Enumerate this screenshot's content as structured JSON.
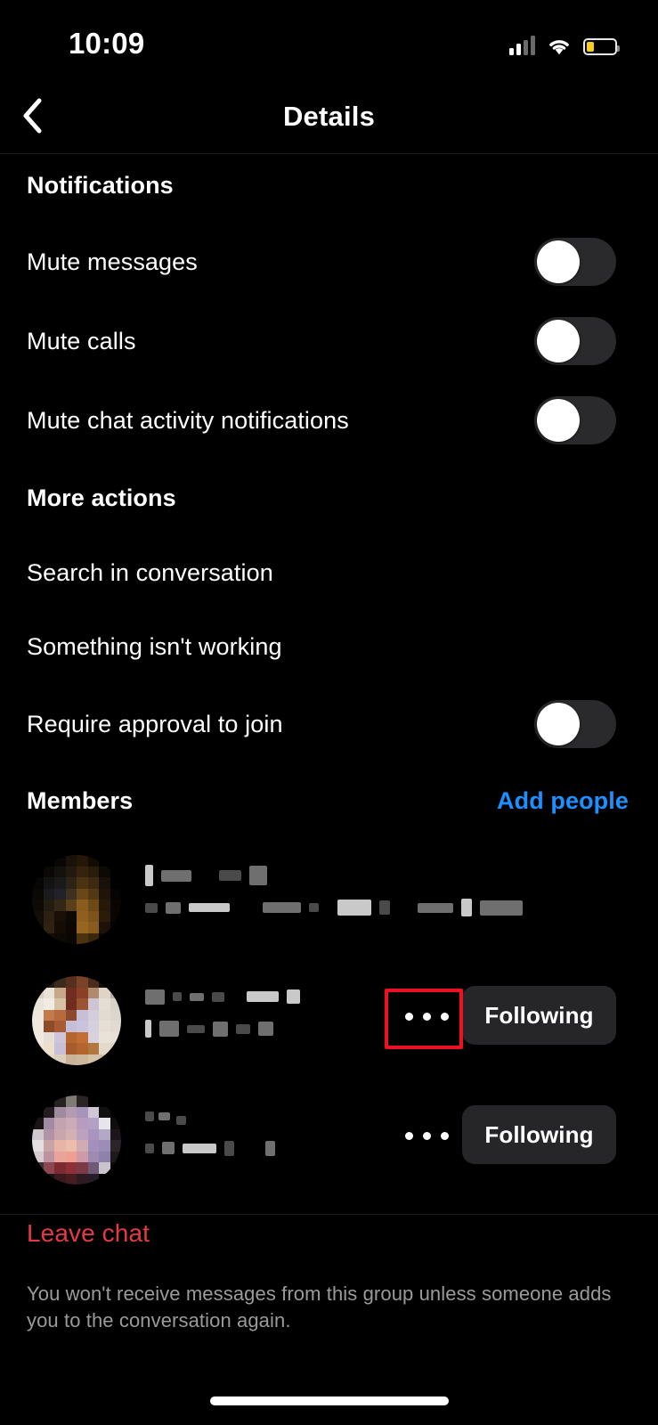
{
  "status_bar": {
    "time": "10:09",
    "signal_icon": "cellular-signal-icon",
    "wifi_icon": "wifi-icon",
    "battery_icon": "battery-low-icon",
    "battery_color": "#f5cf1d"
  },
  "nav": {
    "back_icon": "chevron-left-icon",
    "title": "Details"
  },
  "sections": {
    "notifications": {
      "heading": "Notifications",
      "rows": [
        {
          "label": "Mute messages",
          "toggle": "off"
        },
        {
          "label": "Mute calls",
          "toggle": "off"
        },
        {
          "label": "Mute chat activity notifications",
          "toggle": "off"
        }
      ]
    },
    "more_actions": {
      "heading": "More actions",
      "rows": [
        {
          "label": "Search in conversation",
          "toggle": null
        },
        {
          "label": "Something isn't working",
          "toggle": null
        },
        {
          "label": "Require approval to join",
          "toggle": "off"
        }
      ]
    },
    "members": {
      "heading": "Members",
      "add_people_label": "Add people",
      "rows": [
        {
          "name": "",
          "subtitle": "",
          "redacted": true,
          "menu_icon": "ellipsis-icon",
          "action_label": "",
          "has_action": false,
          "highlighted": false
        },
        {
          "name": "",
          "subtitle": "",
          "redacted": true,
          "menu_icon": "ellipsis-icon",
          "action_label": "Following",
          "has_action": true,
          "highlighted": true
        },
        {
          "name": "",
          "subtitle": "",
          "redacted": true,
          "menu_icon": "ellipsis-icon",
          "action_label": "Following",
          "has_action": true,
          "highlighted": false
        }
      ]
    }
  },
  "footer": {
    "leave_label": "Leave chat",
    "leave_color": "#e53946",
    "note": "You won't receive messages from this group unless someone adds you to the conversation again."
  },
  "annotation": {
    "highlight_color": "#ee1122",
    "target": "ellipsis-icon on second member row"
  }
}
